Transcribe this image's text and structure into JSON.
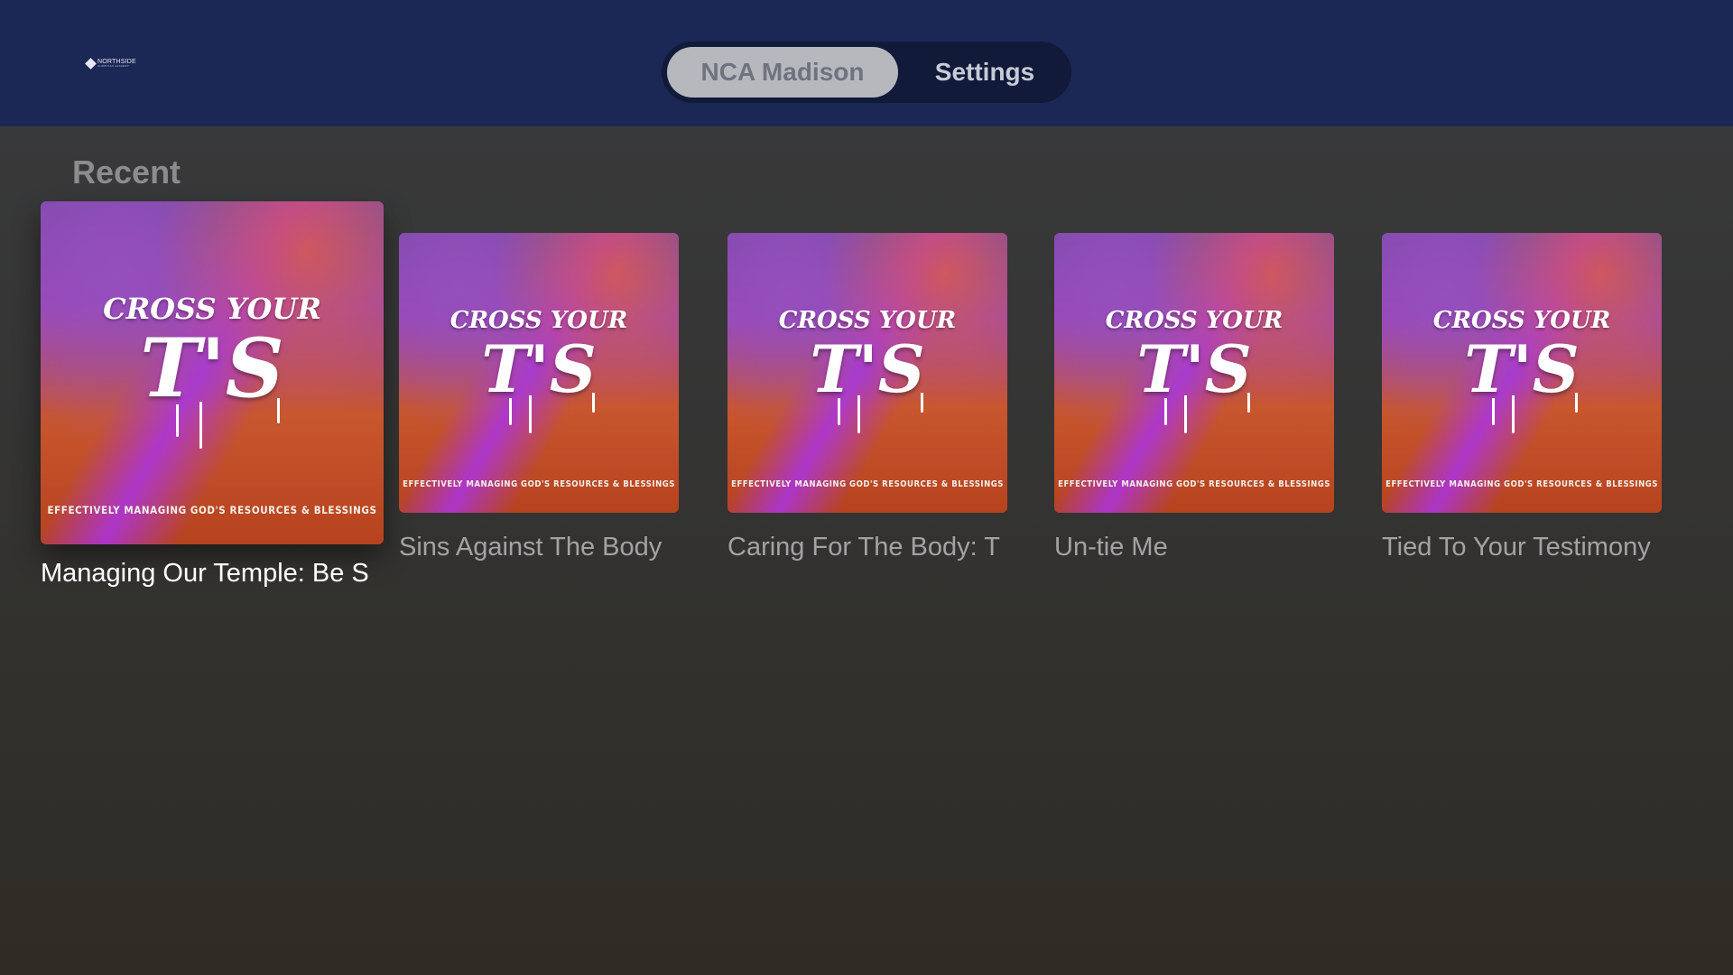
{
  "header": {
    "logo_word": "NORTHSIDE",
    "logo_sub": "CHRISTIAN ACADEMY",
    "tabs": [
      {
        "label": "NCA Madison",
        "selected": true
      },
      {
        "label": "Settings",
        "selected": false
      }
    ]
  },
  "section": {
    "title": "Recent"
  },
  "artwork": {
    "line1": "CROSS YOUR",
    "line2": "T'S",
    "subtitle": "EFFECTIVELY MANAGING GOD'S RESOURCES & BLESSINGS"
  },
  "items": [
    {
      "title": "Managing Our Temple: Be S",
      "focused": true
    },
    {
      "title": "Sins Against The Body",
      "focused": false
    },
    {
      "title": "Caring For The Body: T",
      "focused": false
    },
    {
      "title": "Un-tie Me",
      "focused": false
    },
    {
      "title": "Tied To Your Testimony",
      "focused": false
    }
  ],
  "colors": {
    "top_bar": "#1b2755",
    "tab_active_bg": "#b6b8be",
    "focused_caption": "#ffffff",
    "caption": "#a3a3a6"
  }
}
